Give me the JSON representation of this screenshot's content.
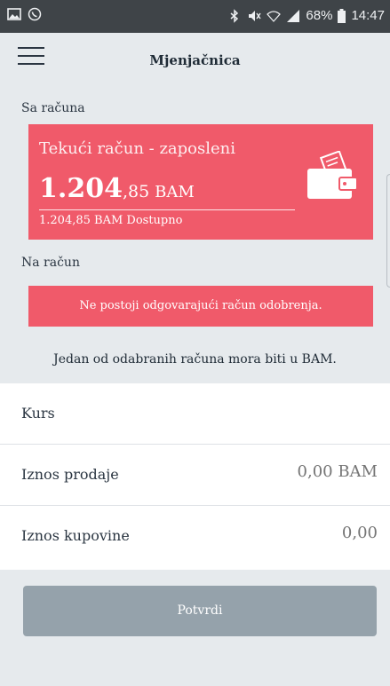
{
  "status_bar": {
    "battery": "68%",
    "time": "14:47",
    "left_icons": [
      "image-icon",
      "whatsapp-icon"
    ],
    "right_icons": [
      "bluetooth-icon",
      "mute-icon",
      "wifi-icon",
      "signal-icon",
      "battery-icon"
    ]
  },
  "header": {
    "title": "Mjenjačnica"
  },
  "from_section": {
    "label": "Sa računa",
    "account_name": "Tekući račun - zaposleni",
    "amount_whole": "1.204",
    "amount_cents": ",85",
    "currency": "BAM",
    "available": "1.204,85 BAM Dostupno"
  },
  "to_section": {
    "label": "Na račun",
    "message": "Ne postoji odgovarajući račun odobrenja."
  },
  "warning": "Jedan od odabranih računa mora biti u BAM.",
  "form": {
    "rate_label": "Kurs",
    "sell_label": "Iznos prodaje",
    "sell_placeholder": "0,00 BAM",
    "buy_label": "Iznos kupovine",
    "buy_placeholder": "0,00"
  },
  "confirm_label": "Potvrdi",
  "colors": {
    "accent": "#f05a6a",
    "button_disabled": "#95a2ab",
    "background": "#e6eaed",
    "status_bar": "#3f4448"
  }
}
